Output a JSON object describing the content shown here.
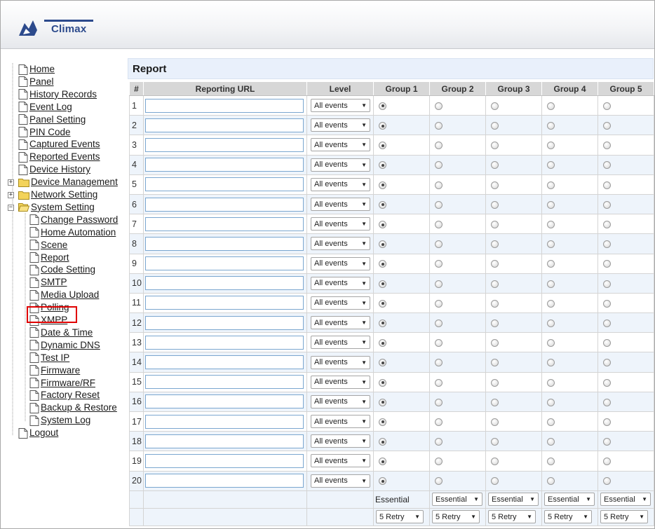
{
  "brand": {
    "name": "Climax"
  },
  "sidebar": {
    "items": [
      {
        "label": "Home",
        "type": "page",
        "indent": 0
      },
      {
        "label": "Panel",
        "type": "page",
        "indent": 0
      },
      {
        "label": "History Records",
        "type": "page",
        "indent": 0
      },
      {
        "label": "Event Log",
        "type": "page",
        "indent": 0
      },
      {
        "label": "Panel Setting",
        "type": "page",
        "indent": 0
      },
      {
        "label": "PIN Code",
        "type": "page",
        "indent": 0
      },
      {
        "label": "Captured Events",
        "type": "page",
        "indent": 0
      },
      {
        "label": "Reported Events",
        "type": "page",
        "indent": 0
      },
      {
        "label": "Device History",
        "type": "page",
        "indent": 0
      },
      {
        "label": "Device Management",
        "type": "folder",
        "toggle": "+",
        "indent": 0
      },
      {
        "label": "Network Setting",
        "type": "folder",
        "toggle": "+",
        "indent": 0
      },
      {
        "label": "System Setting",
        "type": "folder-open",
        "toggle": "−",
        "indent": 0
      },
      {
        "label": "Change Password",
        "type": "page",
        "indent": 1
      },
      {
        "label": "Home Automation",
        "type": "page",
        "indent": 1
      },
      {
        "label": "Scene",
        "type": "page",
        "indent": 1
      },
      {
        "label": "Report",
        "type": "page",
        "indent": 1,
        "selected": true
      },
      {
        "label": "Code Setting",
        "type": "page",
        "indent": 1
      },
      {
        "label": "SMTP",
        "type": "page",
        "indent": 1
      },
      {
        "label": "Media Upload",
        "type": "page",
        "indent": 1
      },
      {
        "label": "Polling",
        "type": "page",
        "indent": 1
      },
      {
        "label": "XMPP",
        "type": "page",
        "indent": 1
      },
      {
        "label": "Date & Time",
        "type": "page",
        "indent": 1
      },
      {
        "label": "Dynamic DNS",
        "type": "page",
        "indent": 1
      },
      {
        "label": "Test IP",
        "type": "page",
        "indent": 1
      },
      {
        "label": "Firmware",
        "type": "page",
        "indent": 1
      },
      {
        "label": "Firmware/RF",
        "type": "page",
        "indent": 1
      },
      {
        "label": "Factory Reset",
        "type": "page",
        "indent": 1
      },
      {
        "label": "Backup & Restore",
        "type": "page",
        "indent": 1
      },
      {
        "label": "System Log",
        "type": "page",
        "indent": 1
      },
      {
        "label": "Logout",
        "type": "page",
        "indent": 0
      }
    ]
  },
  "main": {
    "title": "Report",
    "columns": [
      "#",
      "Reporting URL",
      "Level",
      "Group 1",
      "Group 2",
      "Group 3",
      "Group 4",
      "Group 5"
    ],
    "rows": [
      {
        "num": "1",
        "url": "",
        "level": "All events",
        "group": 1
      },
      {
        "num": "2",
        "url": "",
        "level": "All events",
        "group": 1
      },
      {
        "num": "3",
        "url": "",
        "level": "All events",
        "group": 1
      },
      {
        "num": "4",
        "url": "",
        "level": "All events",
        "group": 1
      },
      {
        "num": "5",
        "url": "",
        "level": "All events",
        "group": 1
      },
      {
        "num": "6",
        "url": "",
        "level": "All events",
        "group": 1
      },
      {
        "num": "7",
        "url": "",
        "level": "All events",
        "group": 1
      },
      {
        "num": "8",
        "url": "",
        "level": "All events",
        "group": 1
      },
      {
        "num": "9",
        "url": "",
        "level": "All events",
        "group": 1
      },
      {
        "num": "10",
        "url": "",
        "level": "All events",
        "group": 1
      },
      {
        "num": "11",
        "url": "",
        "level": "All events",
        "group": 1
      },
      {
        "num": "12",
        "url": "",
        "level": "All events",
        "group": 1
      },
      {
        "num": "13",
        "url": "",
        "level": "All events",
        "group": 1
      },
      {
        "num": "14",
        "url": "",
        "level": "All events",
        "group": 1
      },
      {
        "num": "15",
        "url": "",
        "level": "All events",
        "group": 1
      },
      {
        "num": "16",
        "url": "",
        "level": "All events",
        "group": 1
      },
      {
        "num": "17",
        "url": "",
        "level": "All events",
        "group": 1
      },
      {
        "num": "18",
        "url": "",
        "level": "All events",
        "group": 1
      },
      {
        "num": "19",
        "url": "",
        "level": "All events",
        "group": 1
      },
      {
        "num": "20",
        "url": "",
        "level": "All events",
        "group": 1
      }
    ],
    "group1_label": "Essential",
    "groups": [
      {
        "mode": "Essential",
        "retry": "5 Retry"
      },
      {
        "mode": "Essential",
        "retry": "5 Retry"
      },
      {
        "mode": "Essential",
        "retry": "5 Retry"
      },
      {
        "mode": "Essential",
        "retry": "5 Retry"
      },
      {
        "mode": "Essential",
        "retry": "5 Retry"
      }
    ]
  },
  "colors": {
    "title_bar_bg": "#e9f0fb",
    "alt_row_bg": "#eef4fb",
    "header_bg": "#d7d7d7",
    "highlight": "#e00000",
    "brand": "#2c4a8c"
  }
}
